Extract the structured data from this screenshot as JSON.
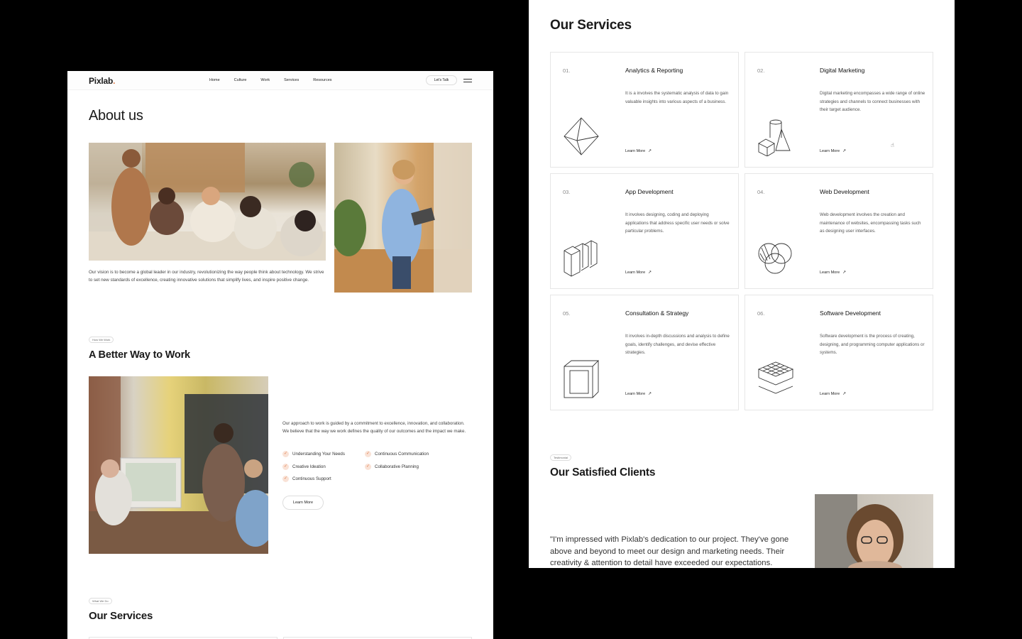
{
  "brand": {
    "name": "Pixlab",
    "dot": ".",
    "accent": "#e07b48"
  },
  "nav": {
    "items": [
      "Home",
      "Culture",
      "Work",
      "Services",
      "Resources"
    ],
    "cta": "Let's Talk"
  },
  "about": {
    "title": "About us",
    "text": "Our vision is to become a global leader in our industry, revolutionizing the way people think about technology. We strive to set new standards of excellence, creating innovative solutions that simplify lives, and inspire positive change."
  },
  "how": {
    "tag": "How We Work",
    "title": "A Better Way to Work",
    "text": "Our approach to work is guided by a commitment to excellence, innovation, and collaboration. We believe that the way we work defines the quality of our outcomes and the impact we make.",
    "checks": [
      "Understanding Your Needs",
      "Continuous Communication",
      "Creative Ideation",
      "Collaborative Planning",
      "Continuous Support"
    ],
    "button": "Learn More"
  },
  "services": {
    "tag": "What We Do",
    "title": "Our Services",
    "learn_more": "Learn More",
    "items": [
      {
        "num": "01.",
        "title": "Analytics & Reporting",
        "desc": "It is a involves the systematic analysis of data to gain valuable insights into various aspects of a business.",
        "icon": "octahedron-icon"
      },
      {
        "num": "02.",
        "title": "Digital Marketing",
        "desc": "Digital marketing encompasses a wide range of online strategies and channels to connect businesses with their target audience.",
        "icon": "geometric-shapes-icon"
      },
      {
        "num": "03.",
        "title": "App Development",
        "desc": "It involves designing, coding and deploying applications that address specific user needs or solve particular problems.",
        "icon": "stacked-blocks-icon"
      },
      {
        "num": "04.",
        "title": "Web Development",
        "desc": "Web development involves the creation and maintenance of websites, encompassing tasks such as designing user interfaces.",
        "icon": "venn-circles-icon"
      },
      {
        "num": "05.",
        "title": "Consultation & Strategy",
        "desc": "It involves in-depth discussions and analysis to define goals, identify challenges, and devise effective strategies.",
        "icon": "wire-cube-icon"
      },
      {
        "num": "06.",
        "title": "Software Development",
        "desc": "Software development is the process of creating, designing, and programming computer applications or systems.",
        "icon": "layered-grid-icon"
      }
    ]
  },
  "clients": {
    "tag": "Testimonial",
    "title": "Our Satisfied Clients",
    "quote": "\"I'm impressed with Pixlab's dedication to our project. They've gone above and beyond to meet our design and marketing needs. Their creativity & attention to detail have exceeded our expectations."
  }
}
